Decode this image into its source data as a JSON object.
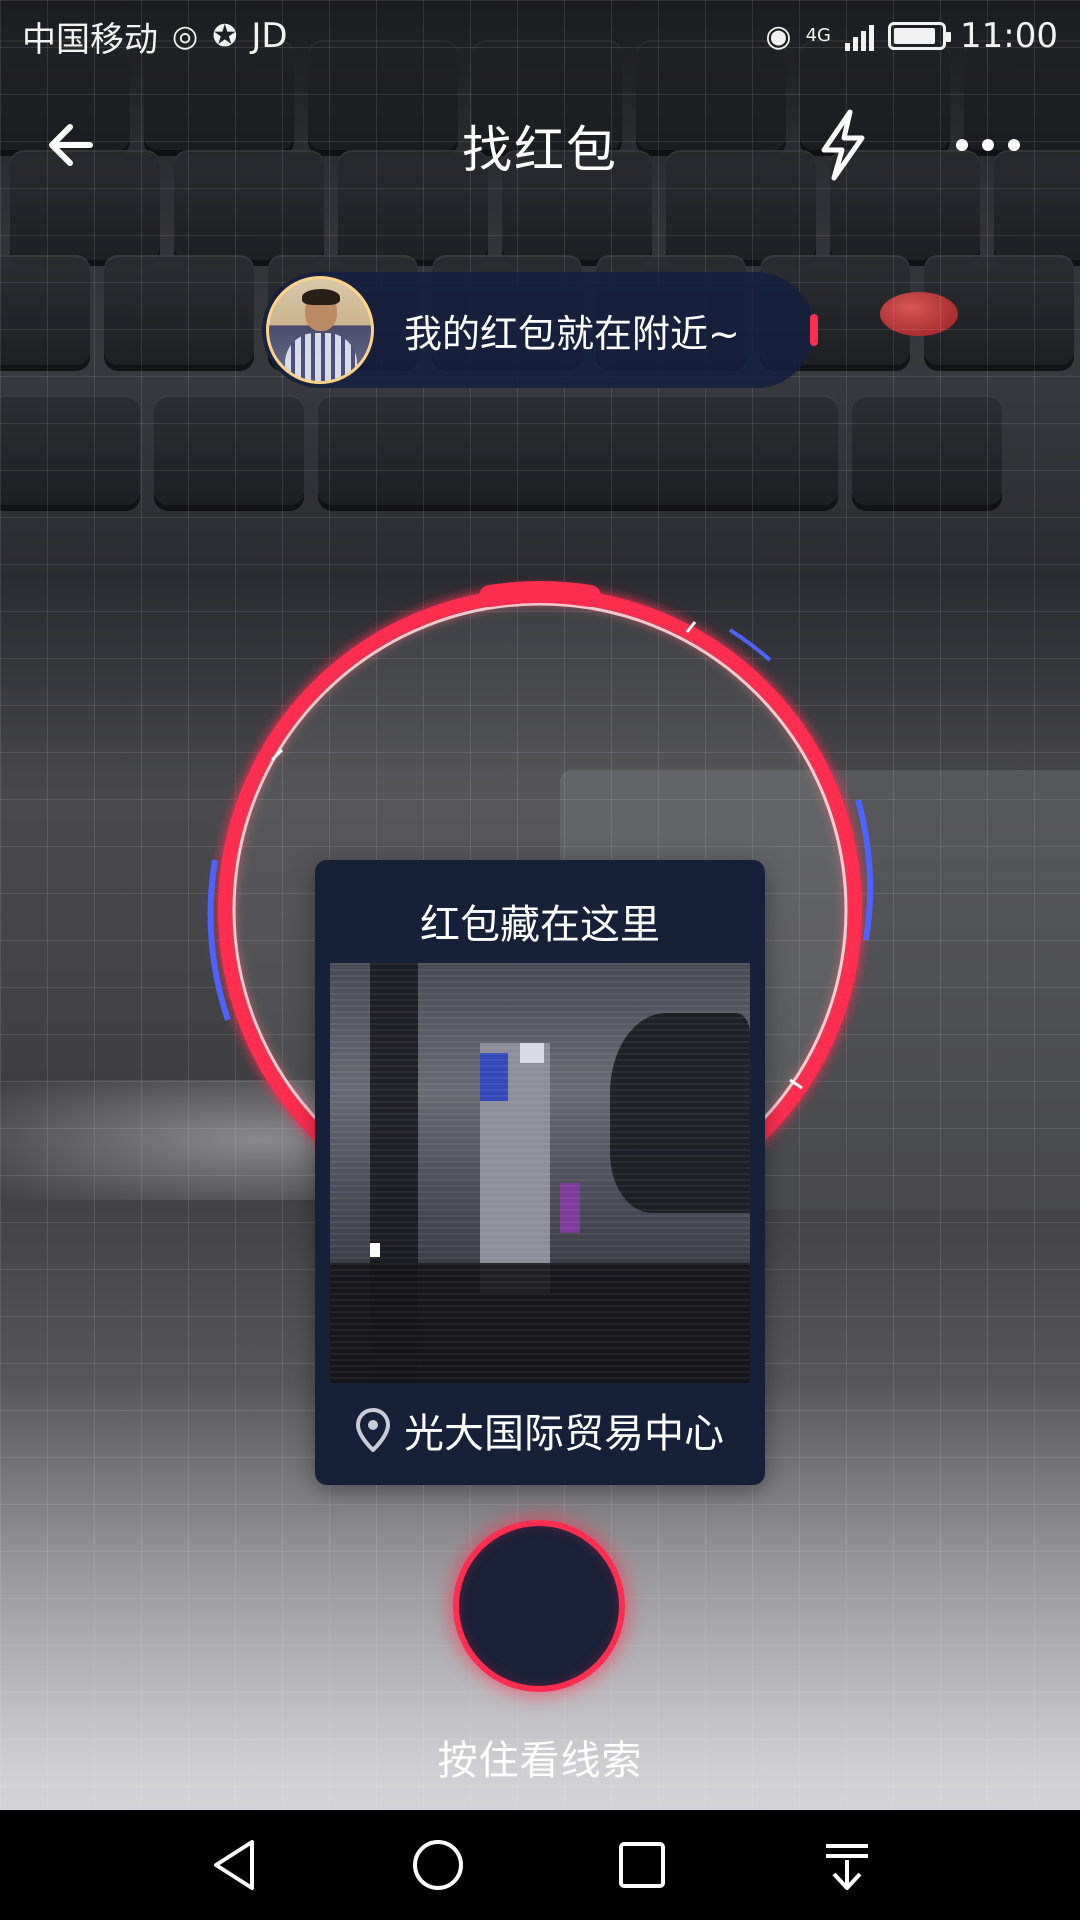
{
  "status_bar": {
    "carrier": "中国移动",
    "app_badge": "JD",
    "network": "4G",
    "time": "11:00"
  },
  "nav": {
    "title": "找红包"
  },
  "message": {
    "text": "我的红包就在附近~"
  },
  "clue_card": {
    "title": "红包藏在这里",
    "location": "光大国际贸易中心"
  },
  "action": {
    "hold_label": "按住看线索"
  },
  "colors": {
    "accent_red": "#ff2d4f",
    "card_navy": "#172039",
    "ring_blue": "#4d63ff"
  },
  "icons": {
    "back": "arrow-left-icon",
    "flash": "flash-icon",
    "more": "more-dots-icon",
    "location": "location-pin-icon",
    "sys_back": "triangle-back-icon",
    "sys_home": "circle-home-icon",
    "sys_recent": "square-recent-icon",
    "sys_notifications": "pull-down-icon"
  }
}
